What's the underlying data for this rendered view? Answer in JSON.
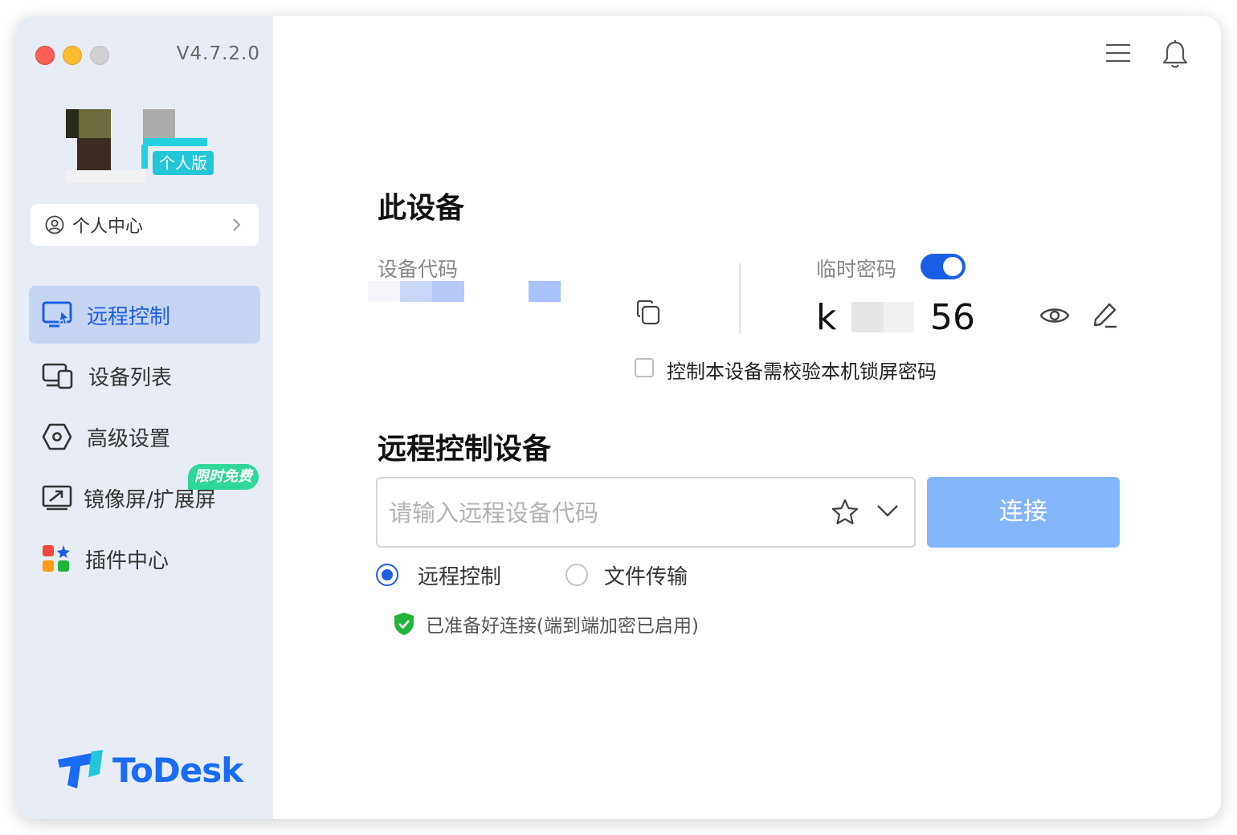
{
  "app": {
    "version": "V4.7.2.0",
    "brand": "ToDesk"
  },
  "sidebar": {
    "edition_badge": "个人版",
    "profile_label": "个人中心",
    "items": [
      {
        "label": "远程控制",
        "icon": "remote-control-icon",
        "active": true
      },
      {
        "label": "设备列表",
        "icon": "device-list-icon",
        "active": false
      },
      {
        "label": "高级设置",
        "icon": "settings-hexagon-icon",
        "active": false
      },
      {
        "label": "镜像屏/扩展屏",
        "icon": "mirror-screen-icon",
        "active": false,
        "badge": "限时免费"
      },
      {
        "label": "插件中心",
        "icon": "plugin-grid-icon",
        "active": false
      }
    ]
  },
  "header": {
    "menu_icon": "hamburger-menu-icon",
    "notification_icon": "bell-icon"
  },
  "this_device": {
    "title": "此设备",
    "code_label": "设备代码",
    "temp_password_label": "临时密码",
    "temp_password_enabled": true,
    "password_prefix": "k",
    "password_suffix": "56",
    "lock_check_label": "控制本设备需校验本机锁屏密码",
    "lock_check_checked": false
  },
  "remote": {
    "title": "远程控制设备",
    "input_placeholder": "请输入远程设备代码",
    "connect_label": "连接",
    "mode_remote_label": "远程控制",
    "mode_file_label": "文件传输",
    "selected_mode": "远程控制",
    "status_text": "已准备好连接(端到端加密已启用)"
  },
  "colors": {
    "accent": "#1b5ee6",
    "sidebar_bg": "#e8edf5",
    "active_item_bg": "#c5d5f1",
    "connect_button": "#84b6fb",
    "badge_cyan": "#22c6d8",
    "badge_green": "#2fd79a",
    "secure_green": "#20b43a"
  }
}
